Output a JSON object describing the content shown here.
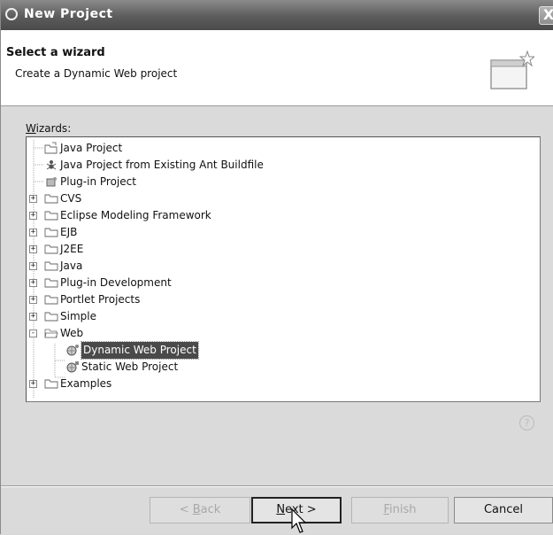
{
  "window": {
    "title": "New Project",
    "close_label": "X"
  },
  "header": {
    "title": "Select a wizard",
    "description": "Create a Dynamic Web project"
  },
  "wizards_label_prefix": "W",
  "wizards_label_rest": "izards:",
  "tree": {
    "items": [
      {
        "label": "Java Project",
        "icon": "java-project-icon",
        "level": 1,
        "expander": ""
      },
      {
        "label": "Java Project from Existing Ant Buildfile",
        "icon": "ant-icon",
        "level": 1,
        "expander": ""
      },
      {
        "label": "Plug-in Project",
        "icon": "plugin-icon",
        "level": 1,
        "expander": ""
      },
      {
        "label": "CVS",
        "icon": "folder-icon",
        "level": 0,
        "expander": "+"
      },
      {
        "label": "Eclipse Modeling Framework",
        "icon": "folder-icon",
        "level": 0,
        "expander": "+"
      },
      {
        "label": "EJB",
        "icon": "folder-icon",
        "level": 0,
        "expander": "+"
      },
      {
        "label": "J2EE",
        "icon": "folder-icon",
        "level": 0,
        "expander": "+"
      },
      {
        "label": "Java",
        "icon": "folder-icon",
        "level": 0,
        "expander": "+"
      },
      {
        "label": "Plug-in Development",
        "icon": "folder-icon",
        "level": 0,
        "expander": "+"
      },
      {
        "label": "Portlet Projects",
        "icon": "folder-icon",
        "level": 0,
        "expander": "+"
      },
      {
        "label": "Simple",
        "icon": "folder-icon",
        "level": 0,
        "expander": "+"
      },
      {
        "label": "Web",
        "icon": "folder-open-icon",
        "level": 0,
        "expander": "-"
      },
      {
        "label": "Dynamic Web Project",
        "icon": "dynamic-web-icon",
        "level": 2,
        "expander": "",
        "selected": true
      },
      {
        "label": "Static Web Project",
        "icon": "static-web-icon",
        "level": 2,
        "expander": ""
      },
      {
        "label": "Examples",
        "icon": "folder-icon",
        "level": 0,
        "expander": "+"
      }
    ]
  },
  "help_label": "?",
  "buttons": {
    "back": {
      "prefix": "< ",
      "mnemonic": "B",
      "rest": "ack",
      "enabled": false
    },
    "next": {
      "prefix": "",
      "mnemonic": "N",
      "rest": "ext >",
      "enabled": true
    },
    "finish": {
      "prefix": "",
      "mnemonic": "F",
      "rest": "inish",
      "enabled": false
    },
    "cancel": {
      "label": "Cancel",
      "enabled": true
    }
  },
  "colors": {
    "selection": "#4a4a4a",
    "folder": "#d9c57a",
    "titlebar": "#5c5c5c"
  }
}
